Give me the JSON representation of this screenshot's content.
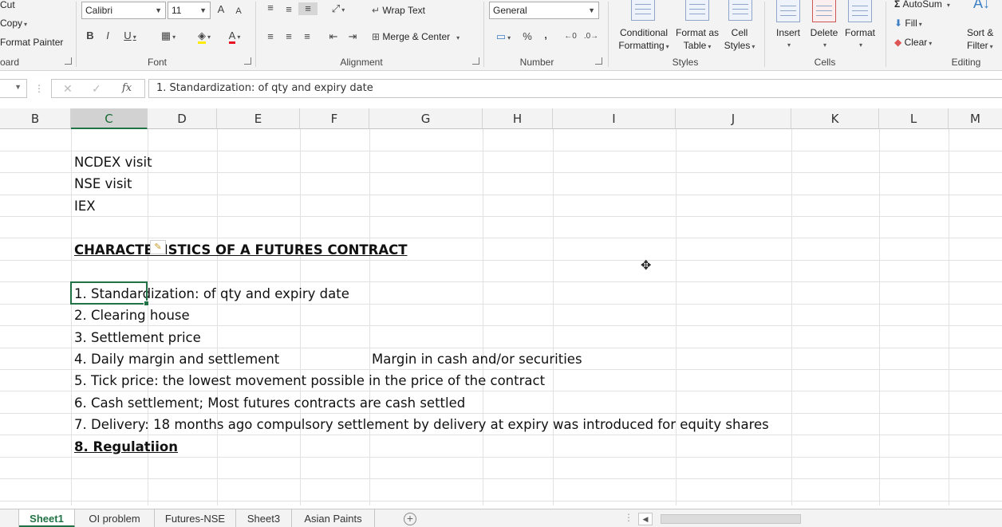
{
  "ribbon": {
    "clipboard": {
      "cut": "Cut",
      "copy": "Copy",
      "format_painter": "Format Painter",
      "group_label": "oard"
    },
    "font": {
      "name": "Calibri",
      "size": "11",
      "bold": "B",
      "italic": "I",
      "underline": "U",
      "grow": "A",
      "shrink": "A",
      "font_color_glyph": "A",
      "group_label": "Font"
    },
    "alignment": {
      "wrap_text": "Wrap Text",
      "merge_center": "Merge & Center",
      "group_label": "Alignment"
    },
    "number": {
      "format": "General",
      "percent": "%",
      "comma": ",",
      "group_label": "Number"
    },
    "styles": {
      "conditional_formatting": [
        "Conditional",
        "Formatting"
      ],
      "format_as_table": [
        "Format as",
        "Table"
      ],
      "cell_styles": [
        "Cell",
        "Styles"
      ],
      "group_label": "Styles"
    },
    "cells": {
      "insert": "Insert",
      "delete": "Delete",
      "format": "Format",
      "group_label": "Cells"
    },
    "editing": {
      "autosum": "AutoSum",
      "fill": "Fill",
      "clear": "Clear",
      "sort_filter": [
        "Sort &",
        "Filter"
      ],
      "group_label": "Editing"
    }
  },
  "formula_bar": {
    "cancel_glyph": "✕",
    "enter_glyph": "✓",
    "fx_glyph": "fx",
    "content": "1. Standardization: of qty and expiry date"
  },
  "columns": [
    "B",
    "C",
    "D",
    "E",
    "F",
    "G",
    "H",
    "I",
    "J",
    "K",
    "L",
    "M"
  ],
  "selected_column": "C",
  "cells": {
    "c2": "NCDEX visit",
    "c3": "NSE visit",
    "c4": "IEX",
    "c6": "CHARACTERISTICS OF A FUTURES CONTRACT",
    "c8": "1. Standardization: of qty and expiry date",
    "c9": "2. Clearing house",
    "c10": "3. Settlement price",
    "c11": "4. Daily margin and settlement",
    "g11": "Margin in cash and/or securities",
    "c12": "5. Tick price: the lowest movement possible in the price of the contract",
    "c13": "6. Cash settlement; Most futures contracts are cash settled",
    "c14": "7. Delivery: 18 months ago compulsory settlement by delivery at expiry was introduced for equity shares",
    "c15": "8. Regulatiion"
  },
  "sheets": [
    "Sheet1",
    "OI problem",
    "Futures-NSE",
    "Sheet3",
    "Asian Paints"
  ],
  "active_sheet": "Sheet1",
  "add_sheet_glyph": "+",
  "colors": {
    "accent": "#217346",
    "ribbon_bg": "#f3f3f3",
    "gridline": "#e1e1e1"
  }
}
